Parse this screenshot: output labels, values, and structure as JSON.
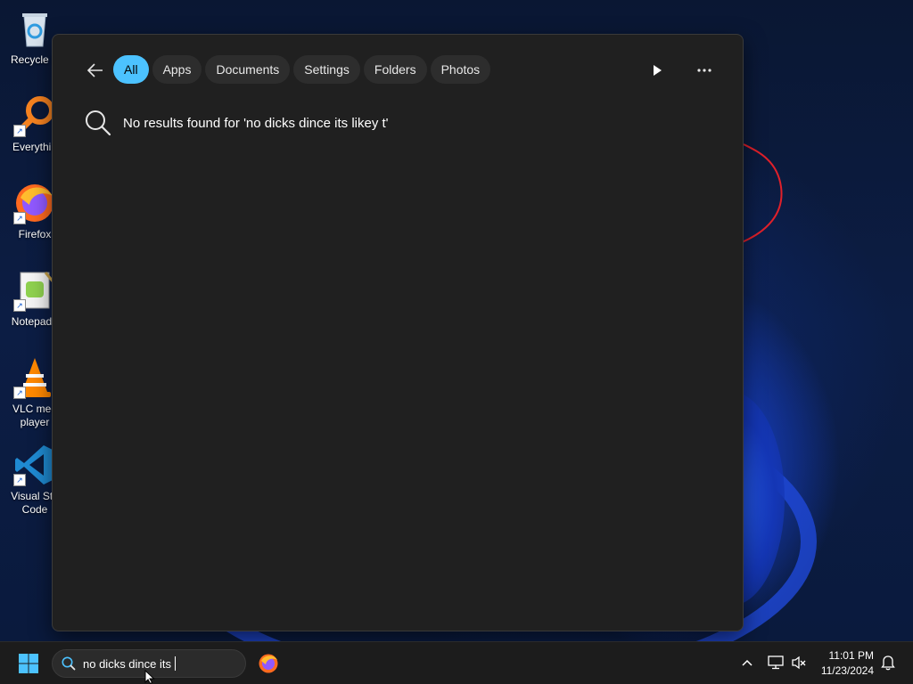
{
  "desktop": {
    "icons": [
      {
        "label": "Recycle B",
        "icon": "recycle-bin-icon"
      },
      {
        "label": "Everythin",
        "icon": "everything-search-icon"
      },
      {
        "label": "Firefox",
        "icon": "firefox-icon"
      },
      {
        "label": "Notepad+",
        "icon": "notepad-plus-plus-icon"
      },
      {
        "label": "VLC med player",
        "icon": "vlc-icon"
      },
      {
        "label": "Visual Stu Code",
        "icon": "vscode-icon"
      }
    ]
  },
  "search_flyout": {
    "filters": [
      "All",
      "Apps",
      "Documents",
      "Settings",
      "Folders",
      "Photos"
    ],
    "active_filter": "All",
    "no_results_text": "No results found for 'no dicks dince its likey t'",
    "accent_color": "#4cc2ff"
  },
  "taskbar": {
    "search_value": "no dicks dince its",
    "clock": {
      "time": "11:01 PM",
      "date": "11/23/2024"
    }
  }
}
